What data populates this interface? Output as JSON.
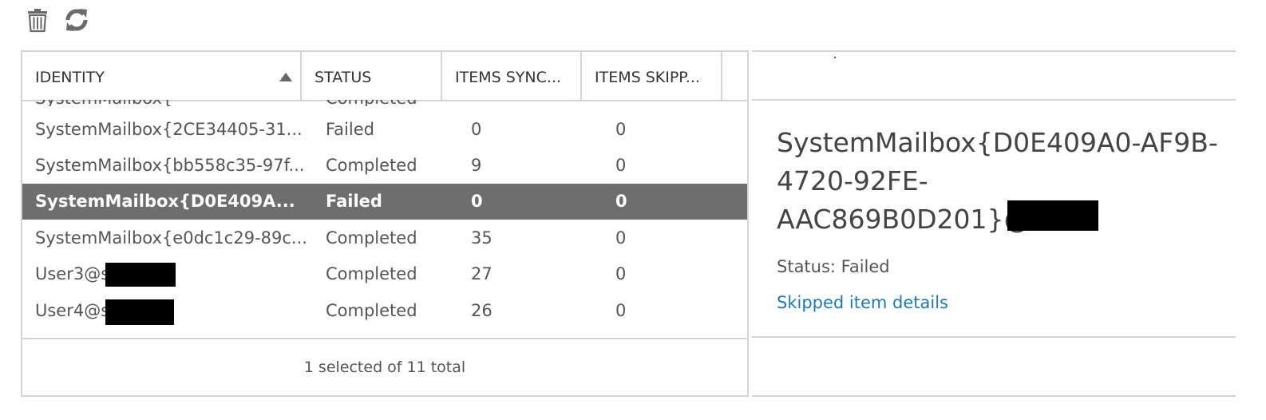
{
  "toolbar": {
    "delete_icon": "trash-icon",
    "refresh_icon": "refresh-icon"
  },
  "table": {
    "columns": [
      "IDENTITY",
      "STATUS",
      "ITEMS SYNC...",
      "ITEMS SKIPP..."
    ],
    "sort": {
      "column": "IDENTITY",
      "direction": "ascending"
    },
    "partial_row": {
      "identity": "SystemMailbox{",
      "status": "Completed"
    },
    "rows": [
      {
        "identity": "SystemMailbox{2CE34405-31...",
        "status": "Failed",
        "items_synced": "0",
        "items_skipped": "0",
        "selected": false
      },
      {
        "identity": "SystemMailbox{bb558c35-97f...",
        "status": "Completed",
        "items_synced": "9",
        "items_skipped": "0",
        "selected": false
      },
      {
        "identity": "SystemMailbox{D0E409A...",
        "status": "Failed",
        "items_synced": "0",
        "items_skipped": "0",
        "selected": true
      },
      {
        "identity": "SystemMailbox{e0dc1c29-89c...",
        "status": "Completed",
        "items_synced": "35",
        "items_skipped": "0",
        "selected": false
      },
      {
        "identity": "User3@s",
        "status": "Completed",
        "items_synced": "27",
        "items_skipped": "0",
        "selected": false
      },
      {
        "identity": "User4@s",
        "status": "Completed",
        "items_synced": "26",
        "items_skipped": "0",
        "selected": false
      }
    ],
    "footer": "1 selected of 11 total"
  },
  "details": {
    "title_lines": [
      "SystemMailbox{D0E409A0-AF9B-",
      "4720-92FE-",
      "AAC869B0D201}@s"
    ],
    "status": "Status: Failed",
    "link": "Skipped item details"
  },
  "colors": {
    "selected_row_bg": "#6e6e6e",
    "link": "#1a7ab8",
    "border": "#d4d4d4"
  }
}
